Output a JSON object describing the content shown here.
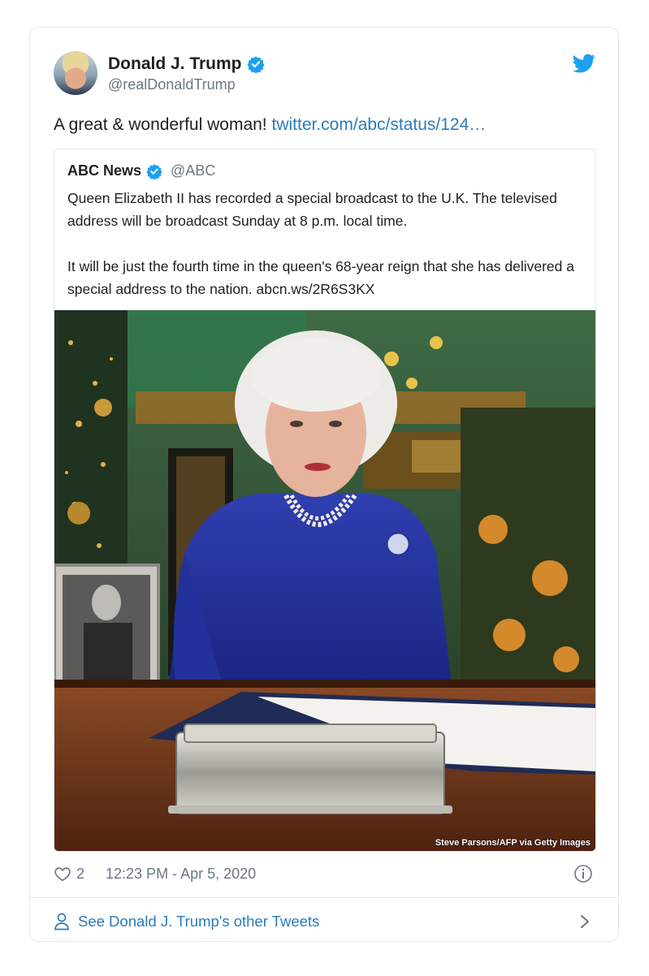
{
  "author": {
    "name": "Donald J. Trump",
    "handle": "@realDonaldTrump"
  },
  "tweet": {
    "text": "A great & wonderful woman! ",
    "link": "twitter.com/abc/status/124…"
  },
  "quoted": {
    "name": "ABC News",
    "handle": "@ABC",
    "paragraph1": "Queen Elizabeth II has recorded a special broadcast to the U.K. The televised address will be broadcast Sunday at 8 p.m. local time.",
    "paragraph2": "It will be just the fourth time in the queen's 68-year reign that she has delivered a special address to the nation. abcn.ws/2R6S3KX",
    "photo_credit": "Steve Parsons/AFP via Getty Images"
  },
  "footer": {
    "likes": "2",
    "timestamp": "12:23 PM - Apr 5, 2020"
  },
  "see_more": "See Donald J. Trump's other Tweets",
  "colors": {
    "link": "#2b7bb9",
    "verified": "#1da1f2",
    "muted": "#697882",
    "border": "#e1e8ed"
  },
  "icons": [
    "verified-icon",
    "twitter-bird-icon",
    "heart-icon",
    "info-icon",
    "person-icon",
    "chevron-right-icon"
  ]
}
